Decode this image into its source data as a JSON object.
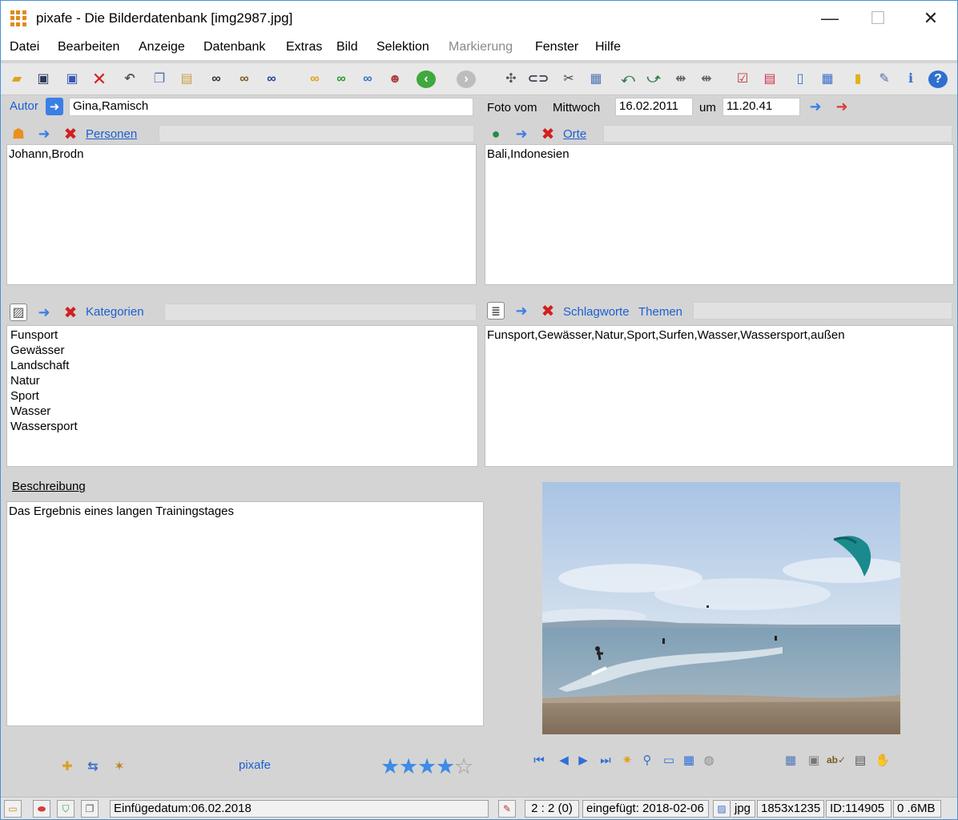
{
  "window": {
    "title": "pixafe - Die Bilderdatenbank  [img2987.jpg]",
    "minimize": "—",
    "maximize": "☐",
    "close": "✕"
  },
  "menu": [
    "Datei",
    "Bearbeiten",
    "Anzeige",
    "Datenbank",
    "Extras",
    "Bild",
    "Selektion",
    "Markierung",
    "Fenster",
    "Hilfe"
  ],
  "toolbar_icons": [
    "open-folder",
    "save",
    "save-as",
    "delete",
    "undo",
    "copy",
    "paste",
    "find",
    "find-next",
    "find-all",
    "search-orange",
    "search-green",
    "search-person",
    "persons",
    "back",
    "forward",
    "shuffle",
    "link",
    "edit-tools",
    "image-edit",
    "rotate-left",
    "rotate-right",
    "flip-left",
    "flip-right",
    "checklist",
    "export",
    "panel-left",
    "panel-grid",
    "database",
    "settings",
    "info",
    "help"
  ],
  "author": {
    "label": "Autor",
    "value": "Gina,Ramisch"
  },
  "photo_date": {
    "label": "Foto vom",
    "weekday": "Mittwoch",
    "date": "16.02.2011",
    "at_label": "um",
    "time": "11.20.41"
  },
  "persons": {
    "label": "Personen",
    "items": [
      "Johann,Brodn"
    ]
  },
  "places": {
    "label": "Orte",
    "items": [
      "Bali,Indonesien"
    ]
  },
  "categories": {
    "label": "Kategorien",
    "items": [
      "Funsport",
      "Gewässer",
      "Landschaft",
      "Natur",
      "Sport",
      "Wasser",
      "Wassersport"
    ]
  },
  "keywords": {
    "label_a": "Schlagworte",
    "label_b": "Themen",
    "items": [
      "Funsport,Gewässer,Natur,Sport,Surfen,Wasser,Wassersport,außen"
    ]
  },
  "description": {
    "label": "Beschreibung",
    "text": "Das Ergebnis eines langen Trainingstages"
  },
  "footer_link": "pixafe",
  "rating": {
    "value": 4,
    "max": 5
  },
  "status": {
    "insert_date": "Einfügedatum:06.02.2018",
    "position": "2 : 2 (0)",
    "inserted": "eingefügt: 2018-02-06",
    "format": "jpg",
    "dimensions": "1853x1235",
    "id": "ID:114905",
    "size": "0 .6MB"
  },
  "colors": {
    "accent": "#1a5fd1",
    "panel_bg": "#d4d4d4",
    "star": "#3d8be8"
  }
}
